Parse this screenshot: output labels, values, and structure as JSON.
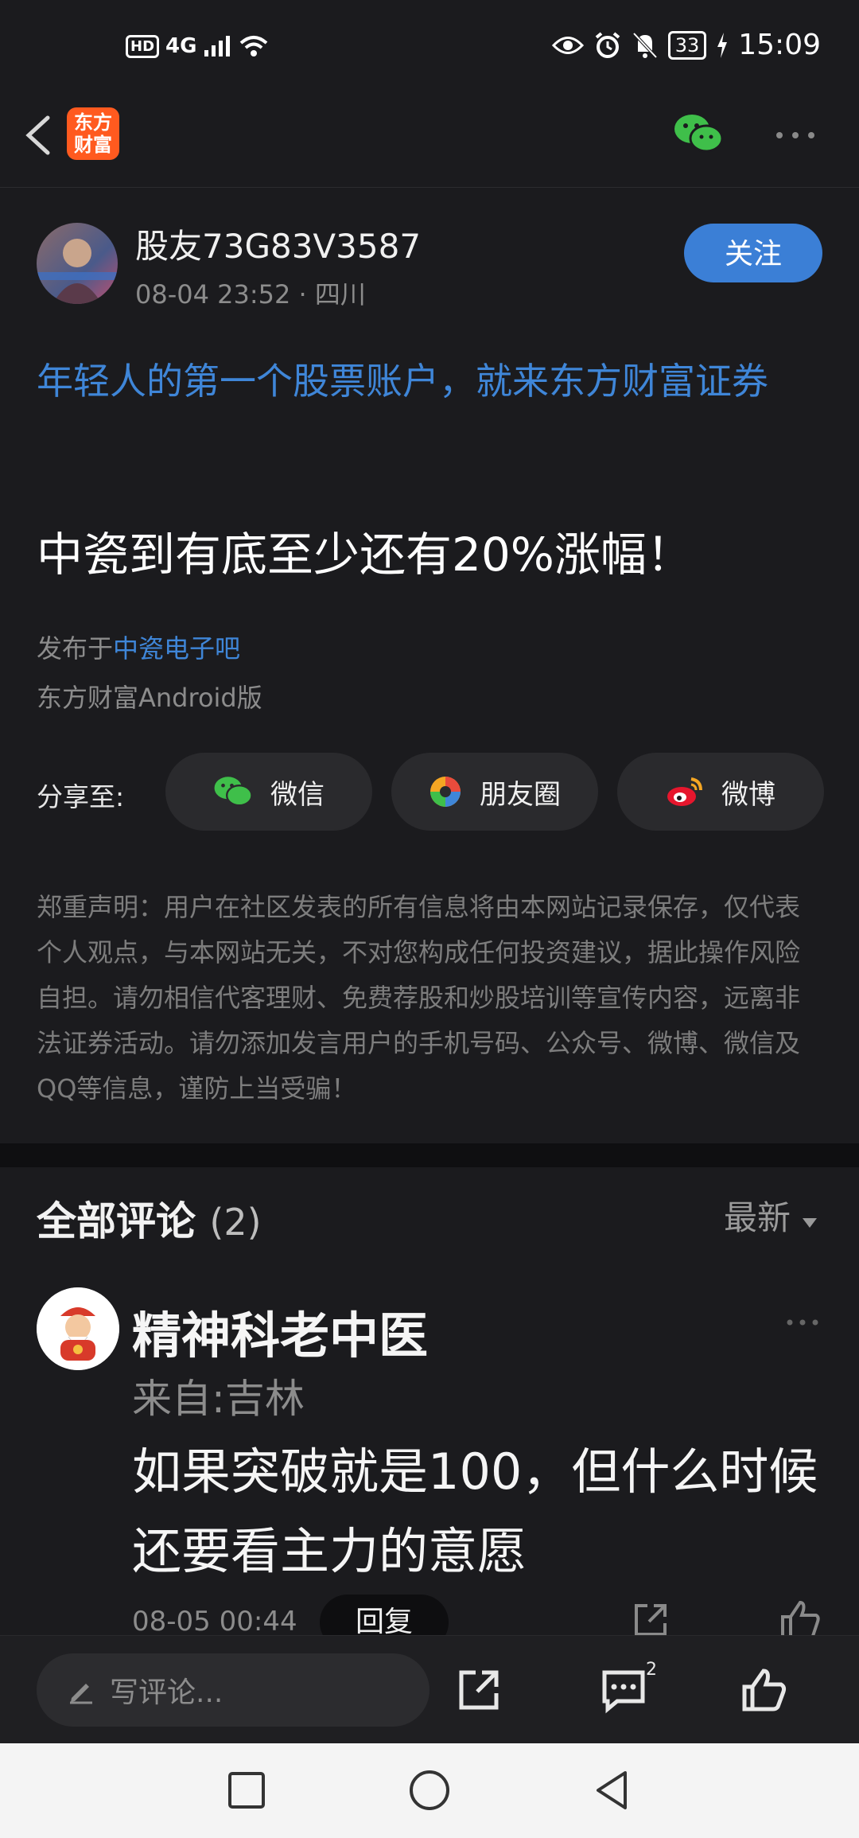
{
  "status_bar": {
    "network": "4G",
    "hd": "HD",
    "battery": "33",
    "time": "15:09"
  },
  "nav": {
    "logo_line1": "东方",
    "logo_line2": "财富",
    "icons": [
      "back-icon",
      "wechat-icon",
      "more-icon"
    ]
  },
  "post": {
    "author": "股友73G83V3587",
    "date": "08-04 23:52",
    "location": "四川",
    "follow_label": "关注",
    "ad_text": "年轻人的第一个股票账户，就来东方财富证券",
    "title": "中瓷到有底至少还有20%涨幅！",
    "posted_in_prefix": "发布于",
    "forum": "中瓷电子吧",
    "client": "东方财富Android版"
  },
  "share": {
    "label": "分享至:",
    "buttons": [
      {
        "label": "微信",
        "icon": "wechat-icon"
      },
      {
        "label": "朋友圈",
        "icon": "moments-icon"
      },
      {
        "label": "微博",
        "icon": "weibo-icon"
      }
    ]
  },
  "disclaimer": "郑重声明：用户在社区发表的所有信息将由本网站记录保存，仅代表个人观点，与本网站无关，不对您构成任何投资建议，据此操作风险自担。请勿相信代客理财、免费荐股和炒股培训等宣传内容，远离非法证券活动。请勿添加发言用户的手机号码、公众号、微博、微信及QQ等信息，谨防上当受骗！",
  "comments": {
    "title": "全部评论",
    "count": "(2)",
    "sort": "最新",
    "items": [
      {
        "name": "精神科老中医",
        "location": "来自:吉林",
        "text": "如果突破就是100，但什么时候还要看主力的意愿",
        "time": "08-05 00:44",
        "reply_label": "回复"
      }
    ]
  },
  "action_bar": {
    "write_placeholder": "写评论...",
    "comment_badge": "2"
  },
  "colors": {
    "accent": "#3b7fd6",
    "link": "#3f86d8",
    "background": "#1b1b1e",
    "brand": "#ff5a1f"
  }
}
